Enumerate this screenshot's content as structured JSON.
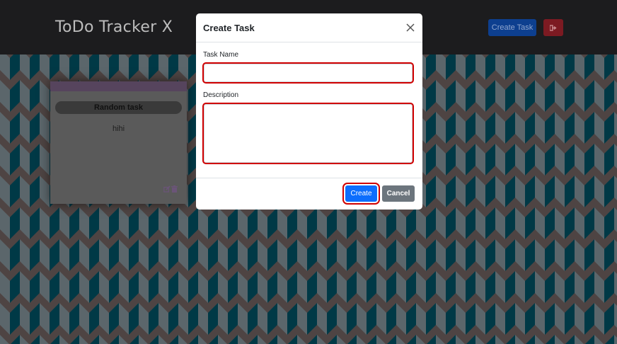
{
  "app": {
    "brand": "ToDo Tracker X",
    "create_task_label": "Create Task",
    "logout_icon": "logout-icon"
  },
  "task_card": {
    "title": "Random task",
    "description": "hihi",
    "edit_icon": "edit-icon",
    "delete_icon": "trash-icon"
  },
  "modal": {
    "title": "Create Task",
    "task_name_label": "Task Name",
    "task_name_value": "",
    "description_label": "Description",
    "description_value": "",
    "create_label": "Create",
    "cancel_label": "Cancel"
  },
  "colors": {
    "primary": "#0d6efd",
    "danger": "#dc3545",
    "secondary": "#6c757d",
    "card_accent": "#b48ad0",
    "pattern_teal": "#004e66",
    "pattern_gray": "#6a7880",
    "pattern_pink": "#9e8889"
  }
}
